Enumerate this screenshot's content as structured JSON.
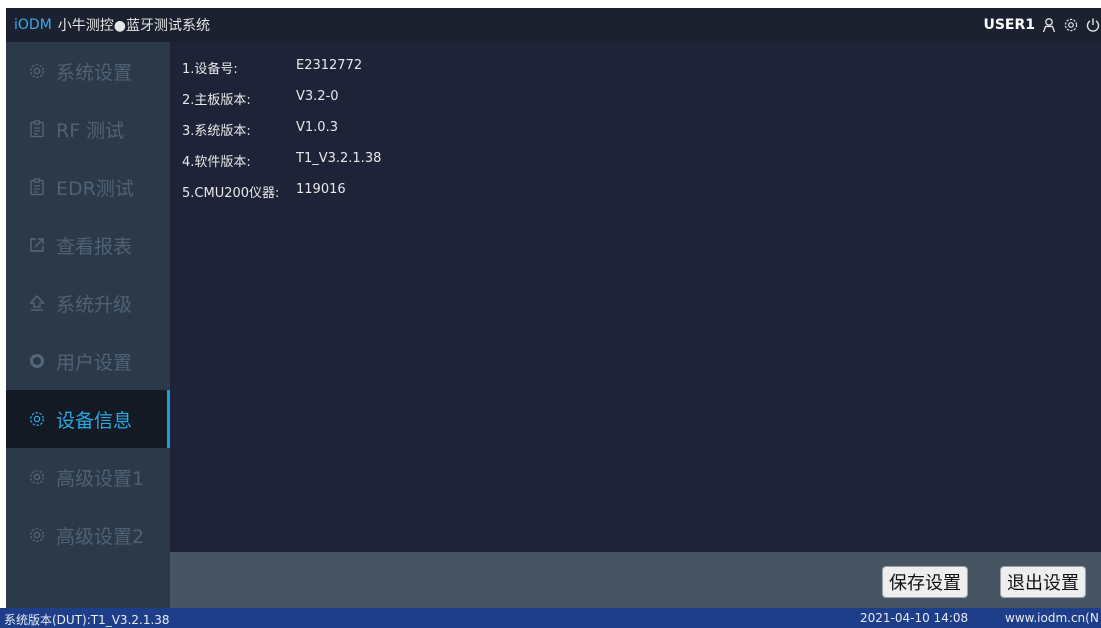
{
  "titlebar": {
    "brand": "iODM",
    "system_name": "小牛测控●蓝牙测试系统",
    "user": "USER1",
    "icons": [
      "user-icon",
      "gear-icon",
      "power-icon"
    ]
  },
  "sidebar": {
    "items": [
      {
        "label": "系统设置",
        "icon": "gear-icon"
      },
      {
        "label": "RF 测试",
        "icon": "clipboard-icon"
      },
      {
        "label": "EDR测试",
        "icon": "clipboard-icon"
      },
      {
        "label": "查看报表",
        "icon": "export-icon"
      },
      {
        "label": "系统升级",
        "icon": "upload-arrow-icon"
      },
      {
        "label": "用户设置",
        "icon": "ring-icon"
      },
      {
        "label": "设备信息",
        "icon": "gear-icon",
        "active": true
      },
      {
        "label": "高级设置1",
        "icon": "gear-icon"
      },
      {
        "label": "高级设置2",
        "icon": "gear-icon"
      }
    ]
  },
  "device_info": [
    {
      "label": "1.设备号:",
      "value": "E2312772"
    },
    {
      "label": "2.主板版本:",
      "value": "V3.2-0"
    },
    {
      "label": "3.系统版本:",
      "value": "V1.0.3"
    },
    {
      "label": "4.软件版本:",
      "value": "T1_V3.2.1.38"
    },
    {
      "label": "5.CMU200仪器:",
      "value": "119016"
    }
  ],
  "actions": {
    "save_label": "保存设置",
    "exit_label": "退出设置"
  },
  "statusbar": {
    "version": "系统版本(DUT):T1_V3.2.1.38",
    "datetime": "2021-04-10 14:08",
    "website": "www.iodm.cn(N"
  },
  "colors": {
    "accent": "#27a9e1",
    "content_bg": "#1e2338",
    "sidebar_bg": "#2c3948",
    "statusbar_bg": "#1f3e8a"
  }
}
